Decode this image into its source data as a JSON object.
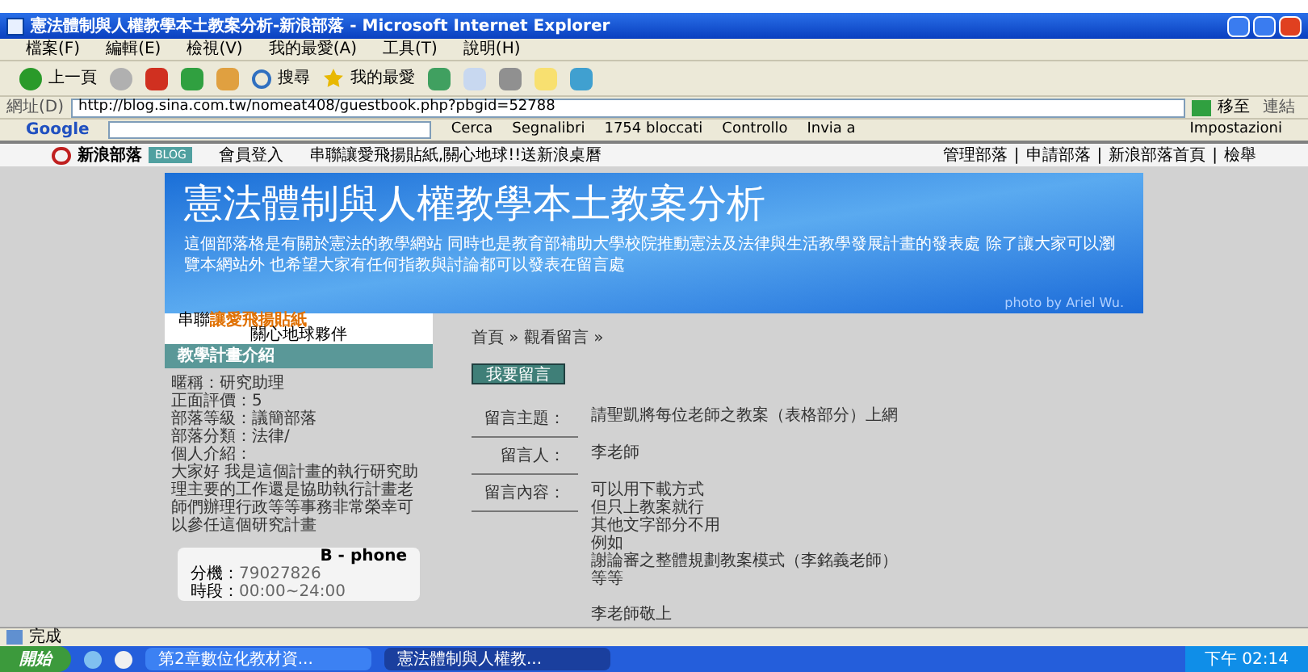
{
  "window": {
    "title": "憲法體制與人權教學本土教案分析-新浪部落 - Microsoft Internet Explorer"
  },
  "menu": [
    "檔案(F)",
    "編輯(E)",
    "檢視(V)",
    "我的最愛(A)",
    "工具(T)",
    "說明(H)"
  ],
  "toolbar": {
    "back": "上一頁",
    "search": "搜尋",
    "favorites": "我的最愛"
  },
  "address": {
    "label": "網址(D)",
    "value": "http://blog.sina.com.tw/nomeat408/guestbook.php?pbgid=52788",
    "go": "移至",
    "links": "連結"
  },
  "google_bar": {
    "logo": "Google",
    "items": [
      "Cerca",
      "Segnalibri",
      "1754 bloccati",
      "Controllo",
      "Invia a"
    ],
    "settings": "Impostazioni"
  },
  "site_bar": {
    "logo": "新浪部落",
    "badge": "BLOG",
    "login": "會員登入",
    "promo": "串聯讓愛飛揚貼紙,關心地球!!送新浪桌曆",
    "links": [
      "管理部落",
      "申請部落",
      "新浪部落首頁",
      "檢舉"
    ],
    "separator": "|"
  },
  "banner": {
    "title": "憲法體制與人權教學本土教案分析",
    "description": "這個部落格是有關於憲法的教學網站 同時也是教育部補助大學校院推動憲法及法律與生活教學發展計畫的發表處 除了讓大家可以瀏覽本網站外 也希望大家有任何指教與討論都可以發表在留言處",
    "credit": "photo by Ariel Wu."
  },
  "ad": {
    "prefix": "串聯",
    "title": "讓愛飛揚貼紙",
    "subtitle": "關心地球夥伴"
  },
  "profile": {
    "heading": "教學計畫介紹",
    "lines": [
      "暱稱：研究助理",
      "正面評價：5",
      "部落等級：議簡部落",
      "部落分類：法律/",
      "個人介紹："
    ],
    "intro": "大家好 我是這個計畫的執行研究助理主要的工作還是協助執行計畫老師們辦理行政等等事務非常榮幸可以參任這個研究計畫"
  },
  "bphone": {
    "title": "B - phone",
    "rows": [
      {
        "label": "分機：",
        "value": "79027826"
      },
      {
        "label": "時段：",
        "value": "00:00~24:00"
      }
    ]
  },
  "breadcrumb": "首頁 » 觀看留言 »",
  "post_button": "我要留言",
  "message": [
    {
      "label": "留言主題：",
      "lines": [
        "請聖凱將每位老師之教案（表格部分）上網"
      ]
    },
    {
      "label": "留言人：",
      "lines": [
        "李老師"
      ]
    },
    {
      "label": "留言內容：",
      "lines": [
        "可以用下載方式",
        "但只上教案就行",
        "其他文字部分不用",
        "例如",
        "謝論審之整體規劃教案模式（李銘義老師）",
        "等等"
      ],
      "signature": "李老師敬上"
    }
  ],
  "status_bar": {
    "text": "完成"
  },
  "taskbar": {
    "start": "開始",
    "tasks": [
      {
        "label": "第2章數位化教材資...",
        "selected": false
      },
      {
        "label": "憲法體制與人權教...",
        "selected": true
      }
    ],
    "clock": "下午 02:14"
  }
}
